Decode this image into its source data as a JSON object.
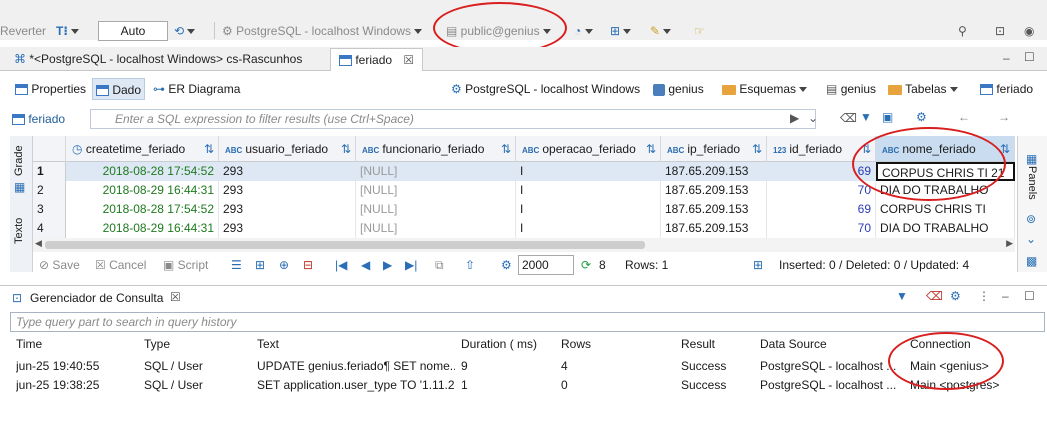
{
  "toolbar": {
    "reverter": "Reverter",
    "mode": "Auto",
    "datasource": "PostgreSQL - localhost Windows",
    "schema": "public@genius"
  },
  "editor_tabs": [
    {
      "label": "*<PostgreSQL - localhost Windows> cs-Rascunhos"
    },
    {
      "label": "feriado"
    }
  ],
  "sub_tabs": {
    "properties": "Properties",
    "data": "Dado",
    "er": "ER Diagrama"
  },
  "breadcrumb": {
    "connection": "PostgreSQL - localhost Windows",
    "database": "genius",
    "schemas": "Esquemas",
    "schema": "genius",
    "tables": "Tabelas",
    "table": "feriado"
  },
  "filter": {
    "table_label": "feriado",
    "placeholder": "Enter a SQL expression to filter results (use Ctrl+Space)"
  },
  "side_tabs": {
    "grid": "Grade",
    "text": "Texto"
  },
  "right_panel": {
    "label": "Panels"
  },
  "grid": {
    "columns": [
      {
        "type": "",
        "name": "createtime_feriado"
      },
      {
        "type": "ABC",
        "name": "usuario_feriado"
      },
      {
        "type": "ABC",
        "name": "funcionario_feriado"
      },
      {
        "type": "ABC",
        "name": "operacao_feriado"
      },
      {
        "type": "ABC",
        "name": "ip_feriado"
      },
      {
        "type": "123",
        "name": "id_feriado"
      },
      {
        "type": "ABC",
        "name": "nome_feriado"
      }
    ],
    "rows": [
      {
        "n": "1",
        "createtime": "2018-08-28 17:54:52",
        "usuario": "293",
        "funcionario": "[NULL]",
        "operacao": "I",
        "ip": "187.65.209.153",
        "id": "69",
        "nome": "CORPUS CHRIS TI 21"
      },
      {
        "n": "2",
        "createtime": "2018-08-29 16:44:31",
        "usuario": "293",
        "funcionario": "[NULL]",
        "operacao": "I",
        "ip": "187.65.209.153",
        "id": "70",
        "nome": "DIA DO TRABALHO"
      },
      {
        "n": "3",
        "createtime": "2018-08-28 17:54:52",
        "usuario": "293",
        "funcionario": "[NULL]",
        "operacao": "I",
        "ip": "187.65.209.153",
        "id": "69",
        "nome": "CORPUS CHRIS TI"
      },
      {
        "n": "4",
        "createtime": "2018-08-29 16:44:31",
        "usuario": "293",
        "funcionario": "[NULL]",
        "operacao": "I",
        "ip": "187.65.209.153",
        "id": "70",
        "nome": "DIA DO TRABALHO"
      }
    ]
  },
  "results_bar": {
    "save": "Save",
    "cancel": "Cancel",
    "script": "Script",
    "fetch_size": "2000",
    "refresh_count": "8",
    "rows": "Rows: 1",
    "stats": "Inserted: 0 / Deleted: 0 / Updated: 4"
  },
  "query_manager": {
    "title": "Gerenciador de Consulta",
    "search_placeholder": "Type query part to search in query history",
    "headers": {
      "time": "Time",
      "type": "Type",
      "text": "Text",
      "duration": "Duration ( ms)",
      "rows": "Rows",
      "result": "Result",
      "datasource": "Data Source",
      "connection": "Connection"
    },
    "rows": [
      {
        "time": "jun-25 19:40:55",
        "type": "SQL / User",
        "text": "UPDATE genius.feriado¶ SET nome...",
        "duration": "9",
        "rows": "4",
        "result": "Success",
        "datasource": "PostgreSQL - localhost ...",
        "connection": "Main <genius>"
      },
      {
        "time": "jun-25 19:38:25",
        "type": "SQL / User",
        "text": "SET application.user_type TO '1.11.2'",
        "duration": "1",
        "rows": "0",
        "result": "Success",
        "datasource": "PostgreSQL - localhost ...",
        "connection": "Main <postgres>"
      }
    ]
  },
  "colors": {
    "accent": "#3b78c4",
    "annotation": "#d81e1e",
    "selected_row": "#dde8f4"
  }
}
